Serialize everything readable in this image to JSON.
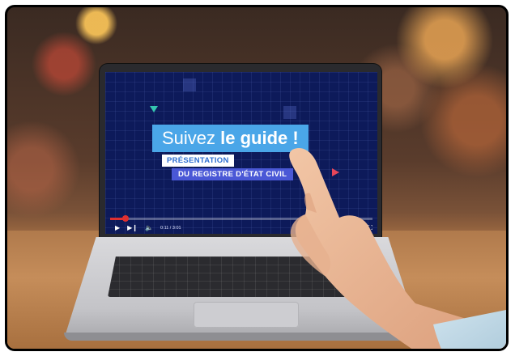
{
  "video": {
    "headline_regular": "Suivez ",
    "headline_bold": "le guide !",
    "subtitle_line1": "PRÉSENTATION",
    "subtitle_line2": "DU REGISTRE D'ÉTAT CIVIL",
    "time": "0:11 / 3:01",
    "progress": 0.06,
    "icons": [
      "play-icon",
      "next-icon",
      "volume-icon",
      "fullscreen-icon"
    ]
  },
  "colors": {
    "screen_bg": "#0d1a5a",
    "headline_bg": "#4aa6e8",
    "subtitle2_bg": "#4a58d6",
    "progress": "#e03030"
  }
}
